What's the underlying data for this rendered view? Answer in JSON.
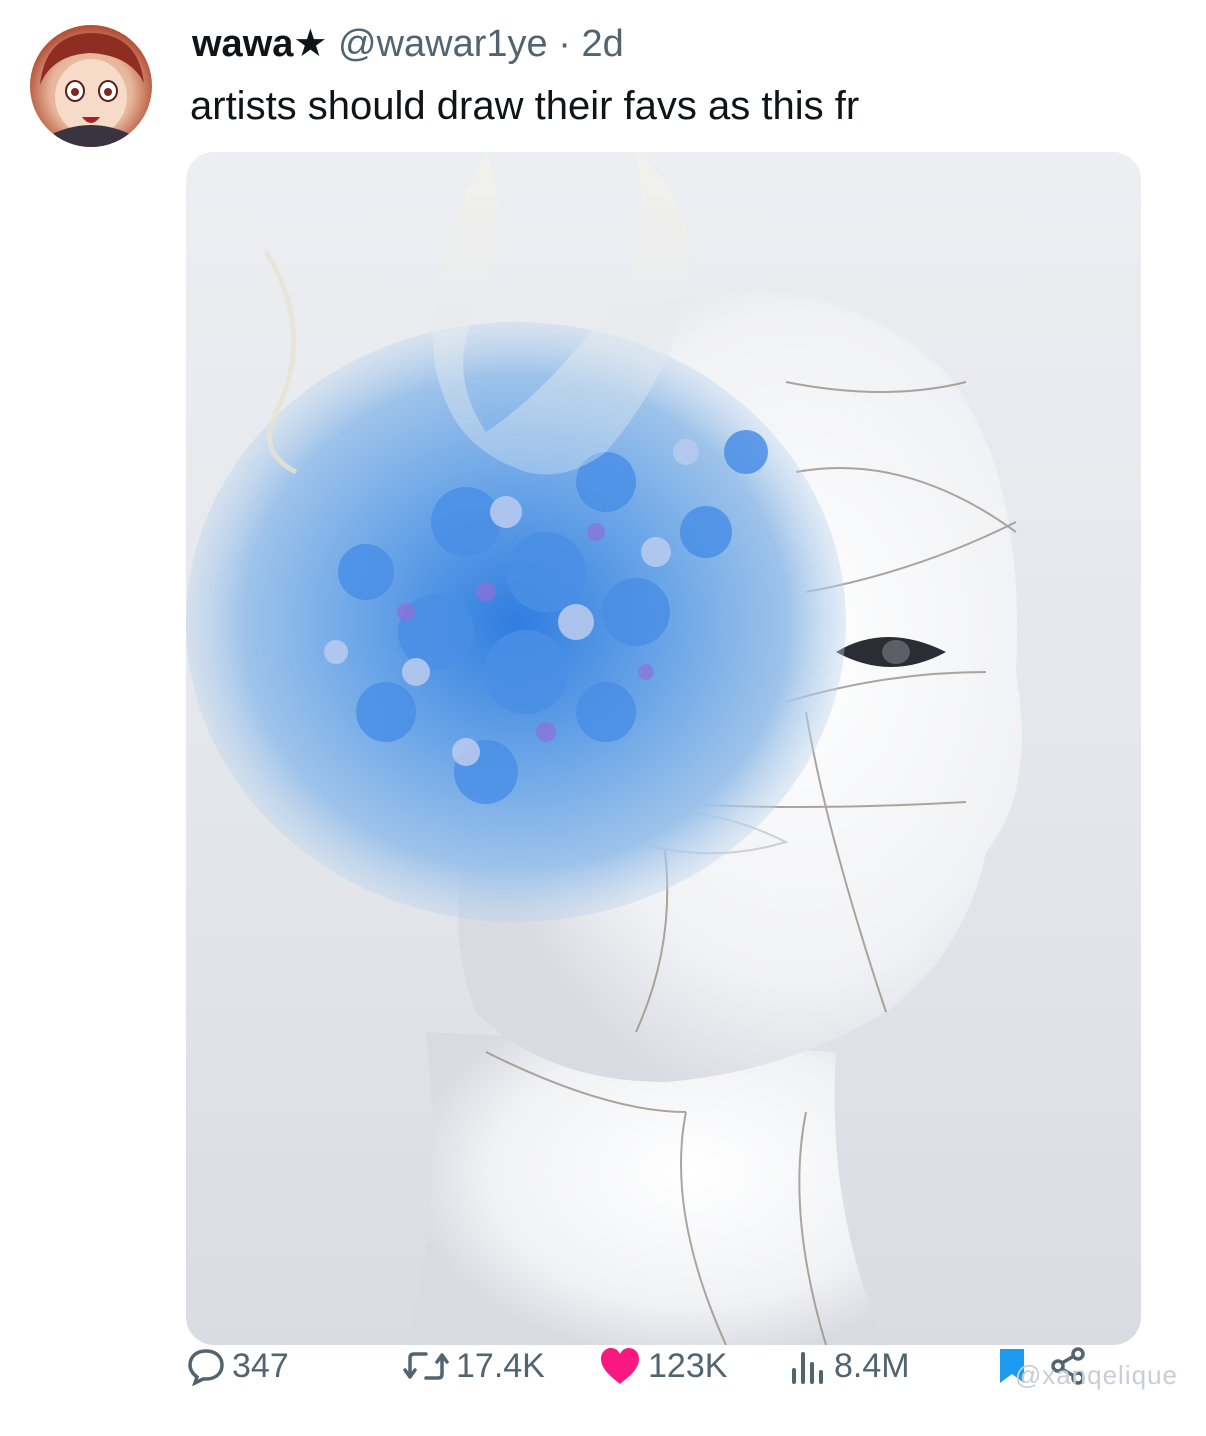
{
  "tweet": {
    "display_name": "wawa",
    "verified_icon": "star-icon",
    "handle": "@wawar1ye",
    "separator": "·",
    "time": "2d",
    "text": "artists should draw their favs as this fr",
    "avatar_icon": "anime-avatar"
  },
  "media": {
    "description_icon": "mannequin-flower-head-image"
  },
  "actions": {
    "reply": {
      "icon": "reply-icon",
      "count": "347"
    },
    "retweet": {
      "icon": "retweet-icon",
      "count": "17.4K"
    },
    "like": {
      "icon": "heart-icon",
      "count": "123K",
      "color": "#f91880"
    },
    "views": {
      "icon": "views-chart-icon",
      "count": "8.4M"
    },
    "bookmark": {
      "icon": "bookmark-icon",
      "color": "#1d9bf0"
    },
    "share": {
      "icon": "share-icon"
    }
  },
  "watermark": "@xanqelique"
}
